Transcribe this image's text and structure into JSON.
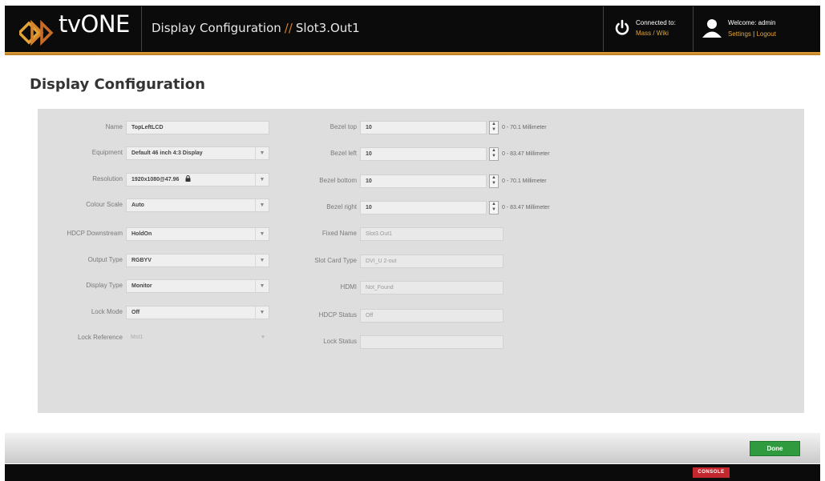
{
  "header": {
    "brand": "tvONE",
    "breadcrumb_section": "Display Configuration",
    "breadcrumb_separator": "//",
    "breadcrumb_item": "Slot3.Out1",
    "connected_label": "Connected to:",
    "connected_value": "Mass / Wiki",
    "welcome_text": "Welcome: admin",
    "settings_link": "Settings",
    "link_separator": "|",
    "logout_link": "Logout",
    "accent_color": "#e2a437"
  },
  "page": {
    "title": "Display Configuration"
  },
  "left_fields": {
    "name": {
      "label": "Name",
      "value": "TopLeftLCD"
    },
    "equipment": {
      "label": "Equipment",
      "value": "Default 46 inch 4:3 Display"
    },
    "resolution": {
      "label": "Resolution",
      "value": "1920x1080@47.96",
      "lock_icon": "lock-icon"
    },
    "colour_scale": {
      "label": "Colour Scale",
      "value": "Auto"
    },
    "hdcp_downstream": {
      "label": "HDCP Downstream",
      "value": "HoldOn"
    },
    "output_type": {
      "label": "Output Type",
      "value": "RGBYV"
    },
    "display_type": {
      "label": "Display Type",
      "value": "Monitor"
    },
    "lock_mode": {
      "label": "Lock Mode",
      "value": "Off"
    },
    "lock_reference": {
      "label": "Lock Reference",
      "value": "Mst1"
    }
  },
  "right_fields": {
    "bezel_top": {
      "label": "Bezel top",
      "value": "10",
      "range": "0 - 70.1 Millimeter"
    },
    "bezel_left": {
      "label": "Bezel left",
      "value": "10",
      "range": "0 - 83.47 Millimeter"
    },
    "bezel_bottom": {
      "label": "Bezel bottom",
      "value": "10",
      "range": "0 - 70.1 Millimeter"
    },
    "bezel_right": {
      "label": "Bezel right",
      "value": "10",
      "range": "0 - 83.47 Millimeter"
    },
    "fixed_name": {
      "label": "Fixed Name",
      "value": "Slot3.Out1"
    },
    "slot_card_type": {
      "label": "Slot Card Type",
      "value": "DVI_U 2-out"
    },
    "hdmi": {
      "label": "HDMI",
      "value": "Not_Found"
    },
    "hdcp_status": {
      "label": "HDCP Status",
      "value": "Off"
    },
    "lock_status": {
      "label": "Lock Status",
      "value": ""
    }
  },
  "footer": {
    "done_label": "Done",
    "console_label": "CONSOLE",
    "done_color": "#2f9a3e",
    "console_color": "#c2282e"
  }
}
